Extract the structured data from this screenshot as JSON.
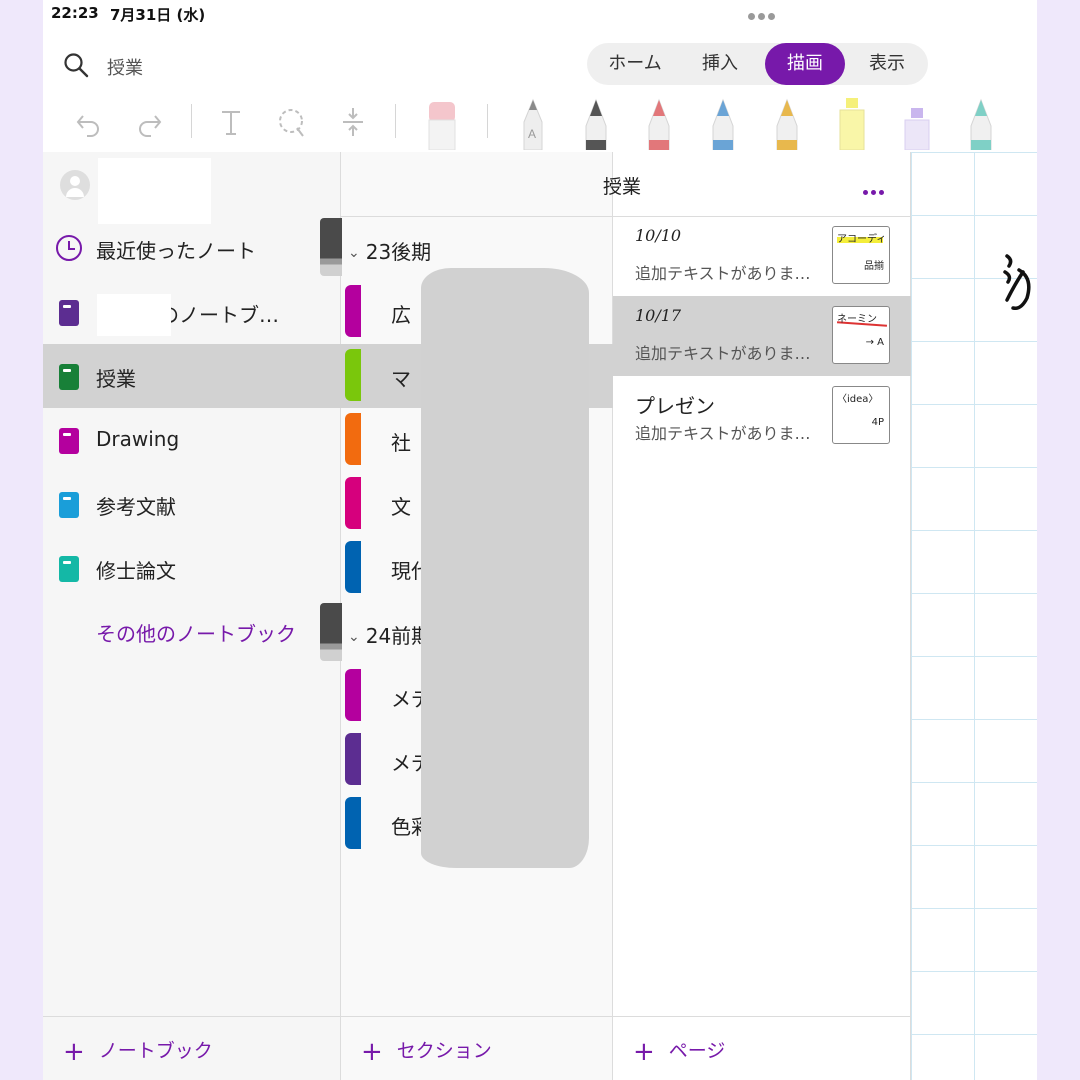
{
  "status_bar": {
    "time": "22:23",
    "date": "7月31日 (水)"
  },
  "search": {
    "text": "授業"
  },
  "ribbon_tabs": [
    {
      "label": "ホーム",
      "active": false
    },
    {
      "label": "挿入",
      "active": false
    },
    {
      "label": "描画",
      "active": true
    },
    {
      "label": "表示",
      "active": false
    }
  ],
  "toolbar": {
    "tools": [
      "undo-icon",
      "redo-icon",
      "text-icon",
      "lasso-icon",
      "insert-space-icon",
      "eraser-icon"
    ],
    "pens": [
      {
        "kind": "pen",
        "color": "#8a8a8a"
      },
      {
        "kind": "pen",
        "color": "#555555"
      },
      {
        "kind": "pen",
        "color": "#e2777a"
      },
      {
        "kind": "pen",
        "color": "#6aa4d6"
      },
      {
        "kind": "pen",
        "color": "#e8b84d"
      },
      {
        "kind": "highlighter",
        "color": "#f5f07a"
      },
      {
        "kind": "highlighter",
        "color": "#c9b6ee"
      },
      {
        "kind": "pen",
        "color": "#7fd0c6"
      }
    ]
  },
  "notebooks_pane": {
    "recent_label": "最近使ったノート",
    "items": [
      {
        "label": "んのノートブ…",
        "color": "#5c2d91",
        "selected": false
      },
      {
        "label": "授業",
        "color": "#188038",
        "selected": true
      },
      {
        "label": "Drawing",
        "color": "#b4009e",
        "selected": false
      },
      {
        "label": "参考文献",
        "color": "#1a9ed9",
        "selected": false
      },
      {
        "label": "修士論文",
        "color": "#14b8a6",
        "selected": false
      }
    ],
    "more_label": "その他のノートブック",
    "add_label": "ノートブック"
  },
  "sections_pane": {
    "title": "授業",
    "groups": [
      {
        "label": "23後期"
      },
      {
        "label": "24前期"
      }
    ],
    "items": [
      {
        "label": "広",
        "color": "#b4009e",
        "selected": false
      },
      {
        "label": "マ",
        "color": "#7ac70c",
        "selected": true
      },
      {
        "label": "社",
        "color": "#f26b0f",
        "selected": false
      },
      {
        "label": "文",
        "color": "#d6007d",
        "selected": false
      },
      {
        "label": "現代",
        "color": "#0063b1",
        "selected": false
      },
      {
        "label": "メデ",
        "color": "#b4009e",
        "selected": false
      },
      {
        "label": "メデ",
        "color": "#5c2d91",
        "selected": false
      },
      {
        "label": "色彩",
        "color": "#0063b1",
        "selected": false
      }
    ],
    "add_label": "セクション"
  },
  "pages_pane": {
    "items": [
      {
        "title": "10/10",
        "subtitle": "追加テキストがありま…",
        "thumb_line1": "アコーディ",
        "thumb_line2": "品揃",
        "selected": false
      },
      {
        "title": "10/17",
        "subtitle": "追加テキストがありま…",
        "thumb_line1": "ネーミン",
        "thumb_line2": "→ A",
        "selected": true
      },
      {
        "title": "プレゼン",
        "subtitle": "追加テキストがありま…",
        "thumb_line1": "〈idea〉",
        "thumb_line2": "4P",
        "selected": false
      }
    ],
    "add_label": "ページ"
  },
  "colors": {
    "accent": "#7719aa",
    "selected_row": "#d2d2d2",
    "grid": "#cfe7f2"
  }
}
